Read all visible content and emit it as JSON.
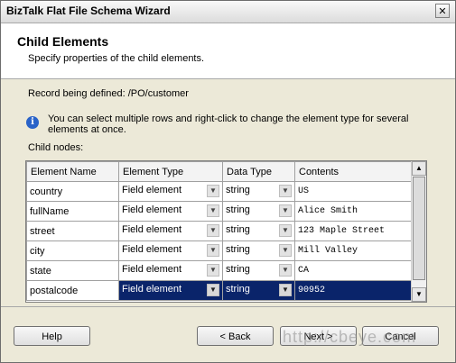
{
  "window": {
    "title": "BizTalk Flat File Schema Wizard",
    "close_glyph": "✕"
  },
  "header": {
    "title": "Child Elements",
    "subtitle": "Specify properties of the child elements."
  },
  "record_line": "Record being defined: /PO/customer",
  "info": {
    "icon": "info-icon",
    "icon_glyph": "i",
    "text": "You can select multiple rows and right-click to change the element type for several elements at once."
  },
  "child_nodes_label": "Child nodes:",
  "grid": {
    "columns": [
      "Element Name",
      "Element Type",
      "Data Type",
      "Contents"
    ],
    "rows": [
      {
        "name": "country",
        "type": "Field element",
        "data_type": "string",
        "contents": "US"
      },
      {
        "name": "fullName",
        "type": "Field element",
        "data_type": "string",
        "contents": "Alice Smith"
      },
      {
        "name": "street",
        "type": "Field element",
        "data_type": "string",
        "contents": "123 Maple Street"
      },
      {
        "name": "city",
        "type": "Field element",
        "data_type": "string",
        "contents": "Mill Valley"
      },
      {
        "name": "state",
        "type": "Field element",
        "data_type": "string",
        "contents": "CA"
      },
      {
        "name": "postalcode",
        "type": "Field element",
        "data_type": "string",
        "contents": "90952"
      }
    ],
    "dropdown_glyph": "▼",
    "scroll_up_glyph": "▲",
    "scroll_down_glyph": "▼"
  },
  "buttons": {
    "help": "Help",
    "back": "< Back",
    "next": "Next >",
    "cancel": "Cancel"
  },
  "watermark": "http://cbeye.com",
  "colors": {
    "selection": "#0a246a",
    "info_icon": "#2a63c8"
  }
}
